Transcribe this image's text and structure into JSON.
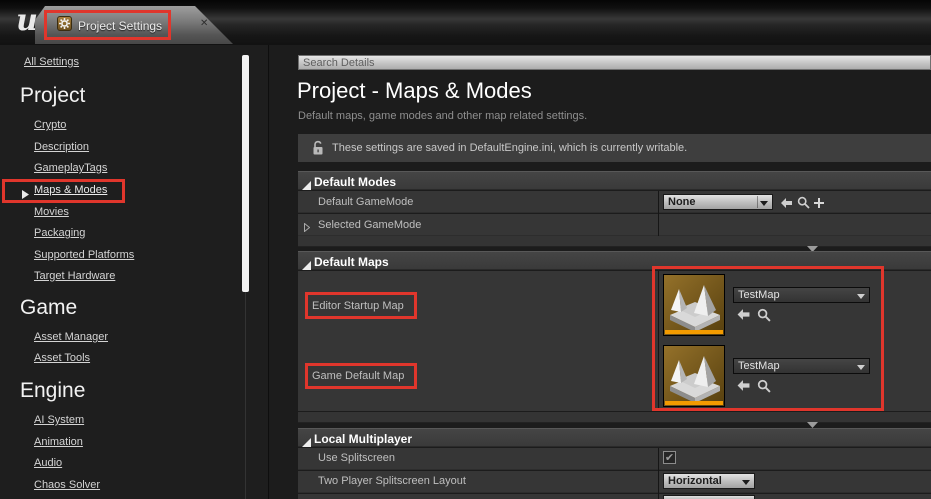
{
  "app": {
    "logo_letter": "u"
  },
  "tab": {
    "label": "Project Settings",
    "close_glyph": "✕"
  },
  "sidebar": {
    "all_settings_label": "All Settings",
    "selected_item": "Maps & Modes",
    "sections": [
      {
        "title": "Project",
        "items": [
          "Crypto",
          "Description",
          "GameplayTags",
          "Maps & Modes",
          "Movies",
          "Packaging",
          "Supported Platforms",
          "Target Hardware"
        ]
      },
      {
        "title": "Game",
        "items": [
          "Asset Manager",
          "Asset Tools"
        ]
      },
      {
        "title": "Engine",
        "items": [
          "AI System",
          "Animation",
          "Audio",
          "Chaos Solver"
        ]
      }
    ]
  },
  "details": {
    "search_placeholder": "Search Details",
    "page_title": "Project - Maps & Modes",
    "page_subtitle": "Default maps, game modes and other map related settings.",
    "config_notice": "These settings are saved in DefaultEngine.ini, which is currently writable.",
    "default_modes": {
      "title": "Default Modes",
      "default_gamemode_label": "Default GameMode",
      "default_gamemode_value": "None",
      "selected_gamemode_label": "Selected GameMode"
    },
    "default_maps": {
      "title": "Default Maps",
      "editor_startup_label": "Editor Startup Map",
      "editor_startup_value": "TestMap",
      "game_default_label": "Game Default Map",
      "game_default_value": "TestMap"
    },
    "local_multiplayer": {
      "title": "Local Multiplayer",
      "use_splitscreen_label": "Use Splitscreen",
      "use_splitscreen_checked": "✔",
      "two_player_label": "Two Player Splitscreen Layout",
      "two_player_value": "Horizontal"
    }
  },
  "colors": {
    "annotation_red": "#e0362c",
    "thumbnail_accent_orange": "#f39b00"
  }
}
